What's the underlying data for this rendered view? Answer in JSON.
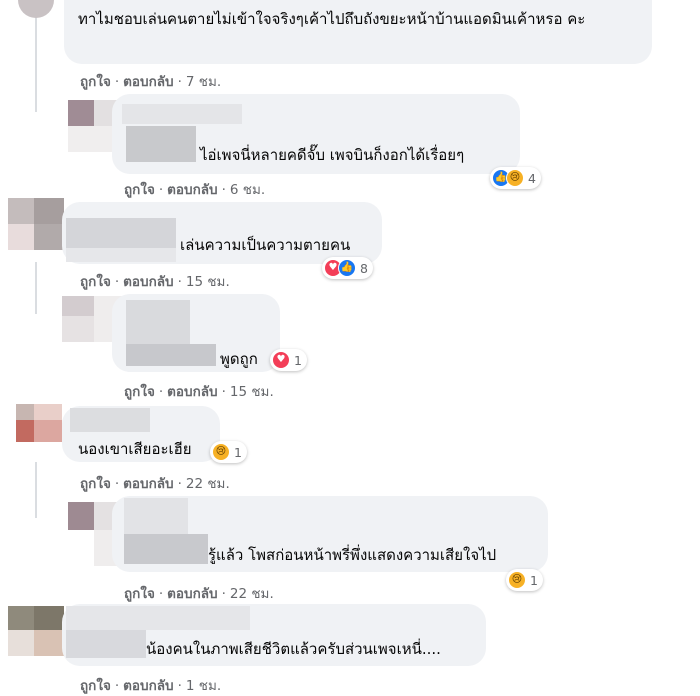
{
  "action_labels": {
    "like": "ถูกใจ",
    "reply": "ตอบกลับ",
    "separator": "·"
  },
  "comments": [
    {
      "text": "ทาไมชอบเล่นคนตายไม่เข้าใจจริงๆเค้าไปถึบถังขยะหน้าบ้านแอดมินเค้าหรอ คะ",
      "time": "7 ชม."
    },
    {
      "text": "ไอ่เพจนี่หลายคดีจั๊บ เพจบินก็งอกได้เรื่อยๆ",
      "time": "6 ชม.",
      "reactions": {
        "icons": [
          "like-icon",
          "sad-icon"
        ],
        "count": "4"
      }
    },
    {
      "text": "เล่นความเป็นความตายคน",
      "time": "15 ชม.",
      "reactions": {
        "icons": [
          "love-icon",
          "like-icon"
        ],
        "count": "8"
      }
    },
    {
      "text": "พูดถูก",
      "time": "15 ชม.",
      "reactions": {
        "icons": [
          "love-icon"
        ],
        "count": "1"
      }
    },
    {
      "text": "นองเขาเสียอะเฮีย",
      "time": "22 ชม.",
      "reactions": {
        "icons": [
          "sad-icon"
        ],
        "count": "1"
      }
    },
    {
      "text": "รู้แล้ว โพสก่อนหน้าพรี่พึ่งแสดงความเสียใจไป",
      "time": "22 ชม.",
      "reactions": {
        "icons": [
          "sad-icon"
        ],
        "count": "1"
      }
    },
    {
      "text": "น้องคนในภาพเสียชีวิตแล้วครับส่วนเพจเหนี่....",
      "time": "1 ชม."
    }
  ],
  "colors": {
    "bubble": "#f0f2f5",
    "meta_text": "#65676b",
    "like": "#1877f2",
    "love": "#f33e58",
    "sad": "#f7b125"
  }
}
